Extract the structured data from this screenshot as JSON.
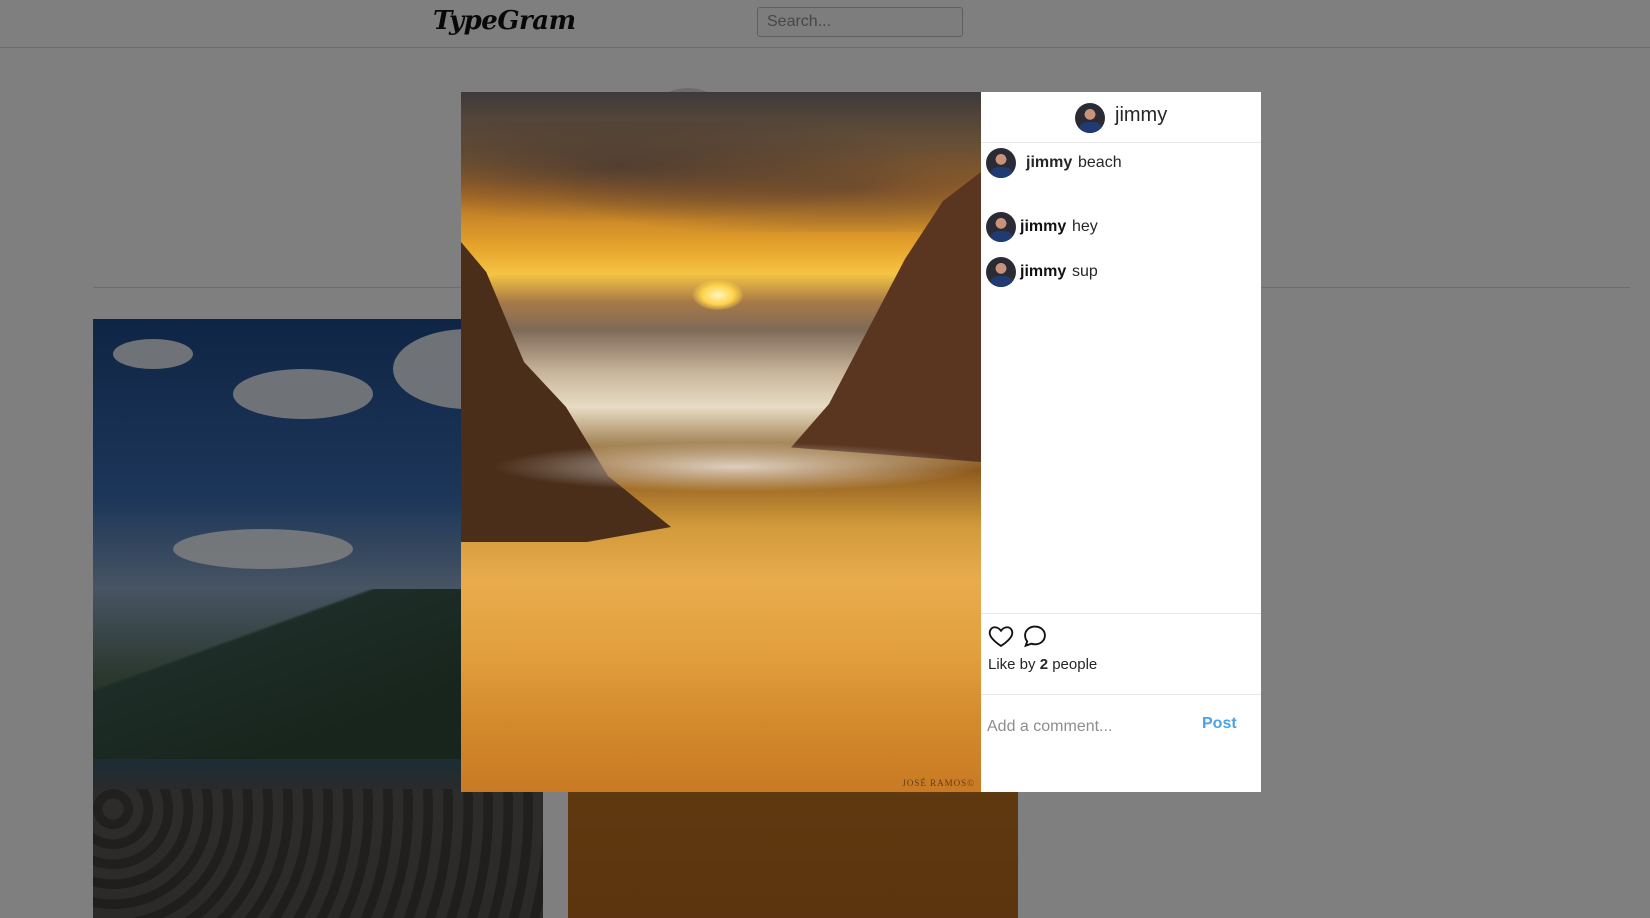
{
  "app": {
    "logo": "TypeGram"
  },
  "search": {
    "placeholder": "Search...",
    "value": ""
  },
  "post": {
    "author": "jimmy",
    "caption": "beach",
    "image_credit": "JOSÉ RAMOS©",
    "comments": [
      {
        "user": "jimmy",
        "text": "hey"
      },
      {
        "user": "jimmy",
        "text": "sup"
      }
    ],
    "likes": {
      "prefix": "Like by",
      "count": "2",
      "suffix": "people"
    }
  },
  "comment_form": {
    "placeholder": "Add a comment...",
    "value": "",
    "post_label": "Post"
  },
  "icons": {
    "like": "heart-icon",
    "comment": "speech-bubble-icon"
  },
  "colors": {
    "post_button": "#4aa3ea",
    "overlay": "rgba(0,0,0,0.5)"
  }
}
